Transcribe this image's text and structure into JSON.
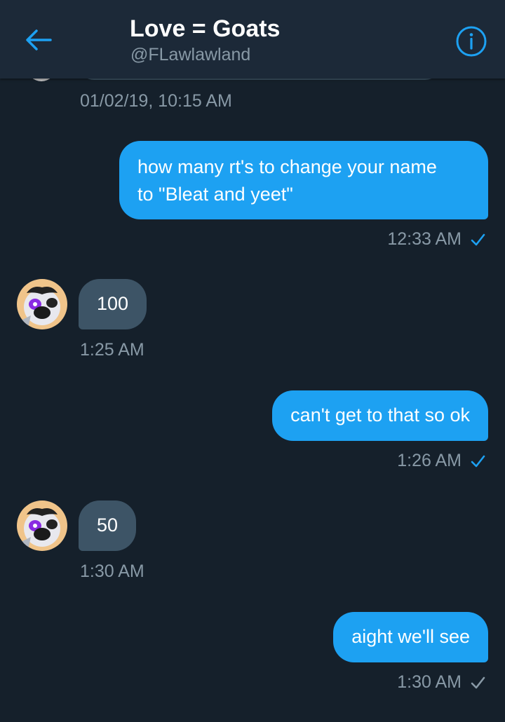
{
  "header": {
    "title": "Love = Goats",
    "handle": "@FLawlawland",
    "back_icon": "arrow-left-icon",
    "info_icon": "info-icon",
    "accent_color": "#1da1f2"
  },
  "conversation": {
    "date_stamp": "01/02/19, 10:15 AM",
    "messages": [
      {
        "direction": "sent",
        "text": "how many rt's to change your name\nto \"Bleat and yeet\"",
        "time": "12:33 AM",
        "status": "read"
      },
      {
        "direction": "received",
        "text": "100",
        "time": "1:25 AM"
      },
      {
        "direction": "sent",
        "text": "can't get to that so ok",
        "time": "1:26 AM",
        "status": "read"
      },
      {
        "direction": "received",
        "text": "50",
        "time": "1:30 AM"
      },
      {
        "direction": "sent",
        "text": "aight we'll see",
        "time": "1:30 AM",
        "status": "sent"
      }
    ]
  },
  "colors": {
    "background": "#15202b",
    "header": "#1c2938",
    "sent_bubble": "#1da1f2",
    "received_bubble": "#3d5466",
    "muted_text": "#8899a6"
  }
}
